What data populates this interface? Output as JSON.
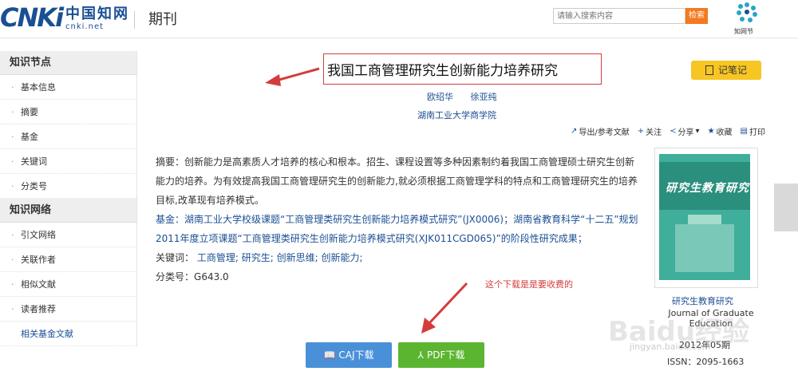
{
  "header": {
    "logo_cnki": "CNKi",
    "logo_cn": "中国知网",
    "logo_net": "cnki.net",
    "section": "期刊",
    "search_placeholder": "请输入搜索内容",
    "search_button": "检索",
    "zhiwang_label": "知网节"
  },
  "sidebar": {
    "group1_title": "知识节点",
    "group1_items": [
      "基本信息",
      "摘要",
      "基金",
      "关键词",
      "分类号"
    ],
    "group2_title": "知识网络",
    "group2_items": [
      "引文网络",
      "关联作者",
      "相似文献",
      "读者推荐",
      "相关基金文献"
    ]
  },
  "article": {
    "title": "我国工商管理研究生创新能力培养研究",
    "authors": [
      "欧绍华",
      "徐亚纯"
    ],
    "affiliation": "湖南工业大学商学院",
    "note_button": "记笔记",
    "toolbar": [
      "导出/参考文献",
      "关注",
      "分享",
      "收藏",
      "打印"
    ],
    "abstract_label": "摘要：",
    "abstract": "创新能力是高素质人才培养的核心和根本。招生、课程设置等多种因素制约着我国工商管理硕士研究生创新能力的培养。为有效提高我国工商管理研究生的创新能力,就必须根据工商管理学科的特点和工商管理研究生的培养目标,改革现有培养模式。",
    "fund_label": "基金：",
    "fund": "湖南工业大学校级课题“工商管理类研究生创新能力培养模式研究”(JX0006)；湖南省教育科学“十二五”规划2011年度立项课题“工商管理类研究生创新能力培养模式研究(XJK011CGD065)”的阶段性研究成果；",
    "keywords_label": "关键词：",
    "keywords": [
      "工商管理;",
      "研究生;",
      "创新思维;",
      "创新能力;"
    ],
    "class_label": "分类号：",
    "class_no": "G643.0"
  },
  "journal": {
    "cover_text": "研究生教育研究",
    "name": "研究生教育研究",
    "name_en": "Journal of Graduate Education",
    "issue": "2012年05期",
    "issn": "ISSN：2095-1663"
  },
  "downloads": {
    "caj": "CAJ下载",
    "pdf": "PDF下载"
  },
  "annotation": "这个下载是是要收费的",
  "watermark": "Baidu经验",
  "watermark_url": "jingyan.baidu.com"
}
